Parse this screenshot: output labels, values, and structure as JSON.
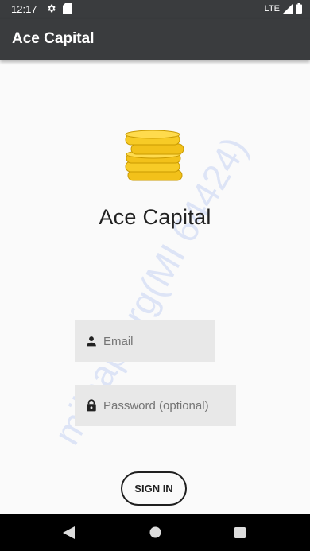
{
  "status_bar": {
    "time": "12:17",
    "network": "LTE",
    "icons": [
      "gear-icon",
      "sd-card-icon",
      "signal-icon",
      "battery-icon"
    ]
  },
  "app_bar": {
    "title": "Ace Capital",
    "color": "#3a3c3e"
  },
  "main": {
    "logo_icon": "coins-stack-icon",
    "brand_title": "Ace Capital",
    "email": {
      "value": "",
      "placeholder": "Email",
      "icon": "person-icon"
    },
    "password": {
      "value": "",
      "placeholder": "Password (optional)",
      "icon": "lock-icon"
    },
    "sign_in_label": "SIGN IN"
  },
  "watermark": "milaap.org(MI 64424)",
  "nav_bar": {
    "icons": [
      "back-icon",
      "home-icon",
      "recents-icon"
    ]
  }
}
